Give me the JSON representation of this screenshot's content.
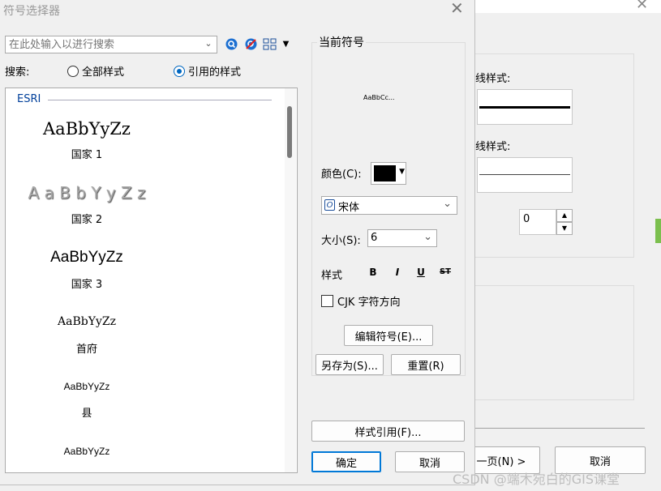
{
  "dialog": {
    "title": "符号选择器",
    "search_placeholder": "在此处输入以进行搜索",
    "search_label": "搜索:",
    "radio_all": "全部样式",
    "radio_referenced": "引用的样式",
    "selected_radio": "referenced",
    "group_header": "ESRI",
    "samples": [
      {
        "preview": "AaBbYyZz",
        "caption": "国家 1"
      },
      {
        "preview": "A a B b Y y Z z",
        "caption": "国家 2"
      },
      {
        "preview": "AaBbYyZz",
        "caption": "国家 3"
      },
      {
        "preview": "AaBbYyZz",
        "caption": "首府"
      },
      {
        "preview": "AaBbYyZz",
        "caption": "县"
      },
      {
        "preview": "AaBbYyZz",
        "caption": ""
      }
    ],
    "current_symbol_label": "当前符号",
    "preview_text": "AaBbCc...",
    "color_label": "颜色(C):",
    "color_value": "#000000",
    "font_value": "宋体",
    "size_label": "大小(S):",
    "size_value": "6",
    "style_label": "样式",
    "style_buttons": [
      "B",
      "I",
      "U",
      "ST"
    ],
    "cjk_label": "CJK 字符方向",
    "edit_symbol_button": "编辑符号(E)...",
    "save_as_button": "另存为(S)...",
    "reset_button": "重置(R)",
    "style_refs_button": "样式引用(F)...",
    "ok_button": "确定",
    "cancel_button": "取消"
  },
  "background": {
    "line_style_label_1": "线样式:",
    "line_style_label_2": "线样式:",
    "spinner_value": "0",
    "next_button": "一页(N) >",
    "cancel_button": "取消"
  },
  "watermark": "CSDN @端木宛白的GIS课堂"
}
